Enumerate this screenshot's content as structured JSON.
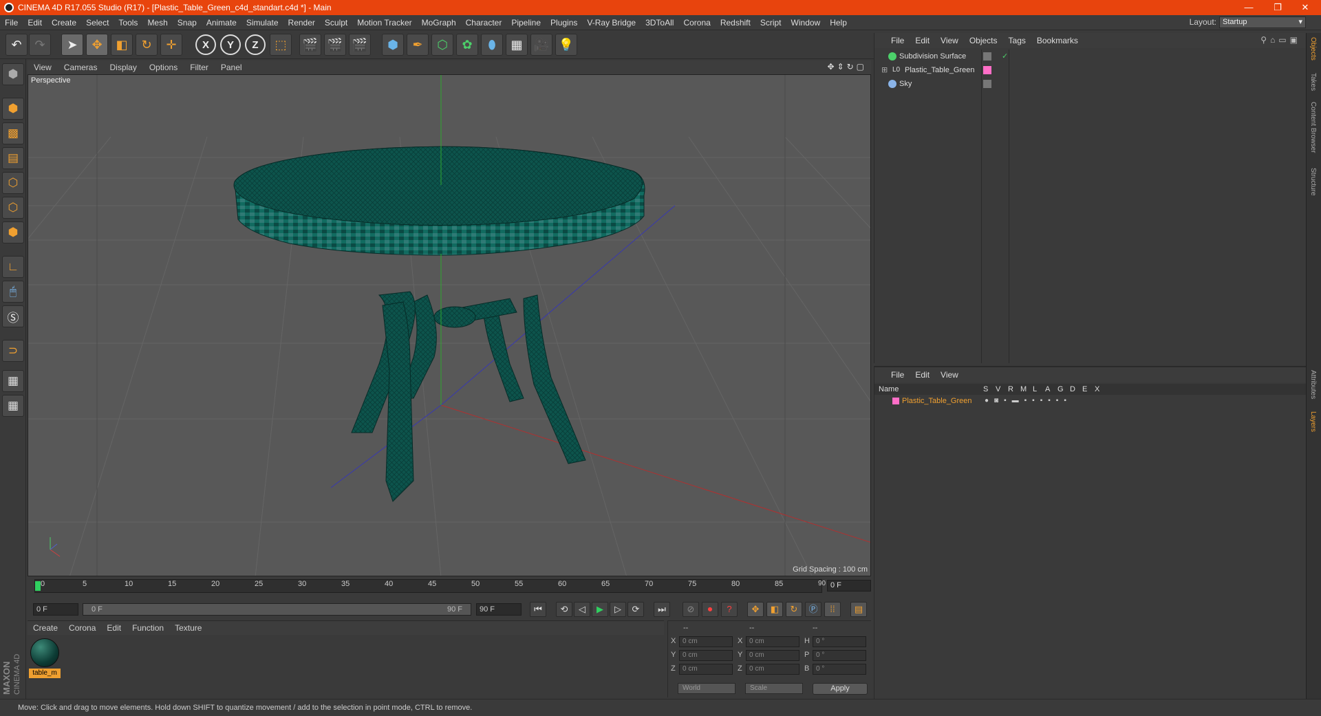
{
  "window": {
    "title": "CINEMA 4D R17.055 Studio (R17) - [Plastic_Table_Green_c4d_standart.c4d *] - Main",
    "minimize": "—",
    "restore": "❐",
    "close": "✕"
  },
  "menubar": [
    "File",
    "Edit",
    "Create",
    "Select",
    "Tools",
    "Mesh",
    "Snap",
    "Animate",
    "Simulate",
    "Render",
    "Sculpt",
    "Motion Tracker",
    "MoGraph",
    "Character",
    "Pipeline",
    "Plugins",
    "V-Ray Bridge",
    "3DToAll",
    "Corona",
    "Redshift",
    "Script",
    "Window",
    "Help"
  ],
  "layout": {
    "label": "Layout:",
    "value": "Startup"
  },
  "toolbar": {
    "undo": "↶",
    "redo": "↷",
    "axis_x": "X",
    "axis_y": "Y",
    "axis_z": "Z"
  },
  "viewport": {
    "menu": [
      "View",
      "Cameras",
      "Display",
      "Options",
      "Filter",
      "Panel"
    ],
    "label": "Perspective",
    "grid_spacing": "Grid Spacing : 100 cm"
  },
  "timeline": {
    "ticks": [
      "0",
      "5",
      "10",
      "15",
      "20",
      "25",
      "30",
      "35",
      "40",
      "45",
      "50",
      "55",
      "60",
      "65",
      "70",
      "75",
      "80",
      "85",
      "90"
    ],
    "current_frame": "0 F",
    "start_field": "0 F",
    "slider_start": "0 F",
    "slider_end": "90 F",
    "end_field": "90 F"
  },
  "material_manager": {
    "menu": [
      "Create",
      "Corona",
      "Edit",
      "Function",
      "Texture"
    ],
    "materials": [
      {
        "name": "table_m"
      }
    ]
  },
  "coordinates": {
    "header": [
      "--",
      "--",
      "--"
    ],
    "rows": [
      {
        "l1": "X",
        "v1": "0 cm",
        "l2": "X",
        "v2": "0 cm",
        "l3": "H",
        "v3": "0 °"
      },
      {
        "l1": "Y",
        "v1": "0 cm",
        "l2": "Y",
        "v2": "0 cm",
        "l3": "P",
        "v3": "0 °"
      },
      {
        "l1": "Z",
        "v1": "0 cm",
        "l2": "Z",
        "v2": "0 cm",
        "l3": "B",
        "v3": "0 °"
      }
    ],
    "mode": "World",
    "scale": "Scale",
    "apply": "Apply"
  },
  "object_manager": {
    "menu": [
      "File",
      "Edit",
      "View",
      "Objects",
      "Tags",
      "Bookmarks"
    ],
    "objects": [
      {
        "name": "Subdivision Surface"
      },
      {
        "name": "Plastic_Table_Green"
      },
      {
        "name": "Sky"
      }
    ]
  },
  "layer_manager": {
    "menu": [
      "File",
      "Edit",
      "View"
    ],
    "columns": [
      "Name",
      "S",
      "V",
      "R",
      "M",
      "L",
      "A",
      "G",
      "D",
      "E",
      "X"
    ],
    "layers": [
      {
        "name": "Plastic_Table_Green",
        "color": "#ff6ec7"
      }
    ]
  },
  "right_tabs": [
    "Objects",
    "Takes",
    "Content Browser",
    "Structure",
    "Attributes",
    "Layers"
  ],
  "status": "Move: Click and drag to move elements. Hold down SHIFT to quantize movement / add to the selection in point mode, CTRL to remove.",
  "brand": {
    "maxon": "MAXON",
    "product": "CINEMA 4D"
  },
  "colors": {
    "title_bar": "#e8440d",
    "accent": "#f0a030",
    "table": "#0e5a52"
  }
}
